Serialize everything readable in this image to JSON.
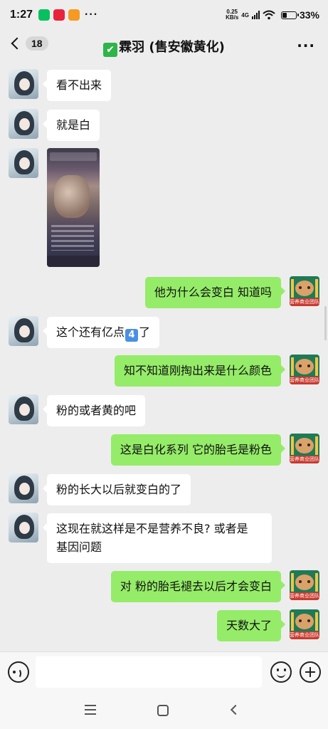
{
  "status_bar": {
    "time": "1:27",
    "net_speed_value": "0.25",
    "net_speed_unit": "KB/s",
    "network_type": "4G",
    "wifi_badge": "6",
    "battery_percent": "33%",
    "battery_level": 0.33,
    "app_icons": [
      "wechat-icon",
      "xiaohongshu-icon",
      "taobao-icon"
    ]
  },
  "header": {
    "unread_count": "18",
    "title": "霖羽 (售安徽黄化)",
    "title_emoji": "✔"
  },
  "messages": [
    {
      "side": "in",
      "type": "text",
      "text": "看不出来"
    },
    {
      "side": "in",
      "type": "text",
      "text": "就是白"
    },
    {
      "side": "in",
      "type": "image"
    },
    {
      "side": "out",
      "type": "text",
      "text": "他为什么会变白 知道吗"
    },
    {
      "side": "in",
      "type": "text",
      "text_before": "这个还有亿点",
      "emoji": "4",
      "text_after": "了"
    },
    {
      "side": "out",
      "type": "text",
      "text": "知不知道刚掏出来是什么颜色"
    },
    {
      "side": "in",
      "type": "text",
      "text": "粉的或者黄的吧"
    },
    {
      "side": "out",
      "type": "text",
      "text": "这是白化系列 它的胎毛是粉色"
    },
    {
      "side": "in",
      "type": "text",
      "text": "粉的长大以后就变白的了"
    },
    {
      "side": "in",
      "type": "text",
      "line1": "这现在就这样是不是营养不良? 或者是",
      "line2": "基因问题"
    },
    {
      "side": "out",
      "type": "text",
      "text": "对 粉的胎毛褪去以后才会变白"
    },
    {
      "side": "out",
      "type": "text",
      "text": "天数大了"
    }
  ],
  "shop_avatar_banner": "营养商业团队",
  "input_bar": {
    "text": ""
  },
  "colors": {
    "outgoing_bubble": "#95ec69",
    "incoming_bubble": "#ffffff",
    "background": "#ededed"
  }
}
